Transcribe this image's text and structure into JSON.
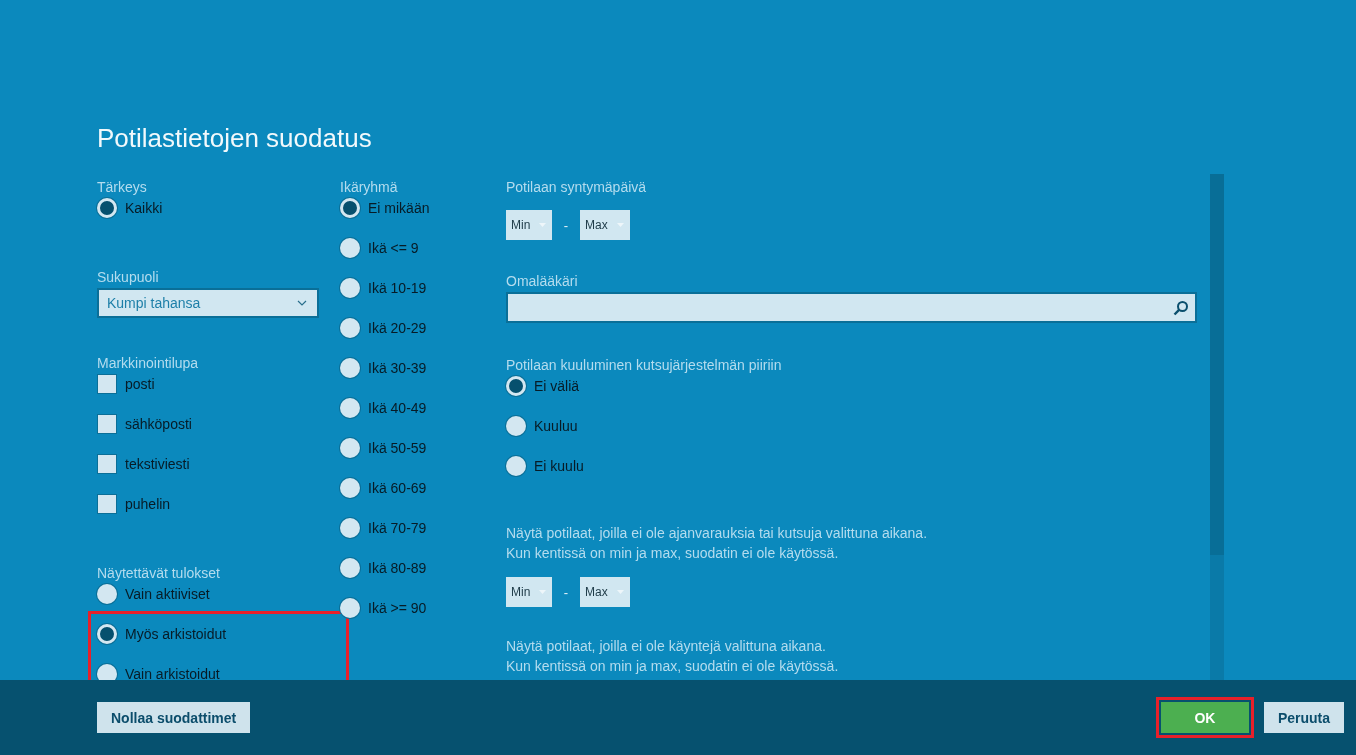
{
  "dialog": {
    "title": "Potilastietojen suodatus"
  },
  "columns": [
    [
      {
        "kind": "radio",
        "label": "Tärkeys",
        "options": [
          {
            "label": "Kaikki",
            "selected": true,
            "highlighted": false
          }
        ]
      },
      {
        "kind": "select",
        "label": "Sukupuoli",
        "value": "Kumpi tahansa"
      },
      {
        "kind": "checkbox",
        "label": "Markkinointilupa",
        "options": [
          {
            "label": "posti",
            "checked": false
          },
          {
            "label": "sähköposti",
            "checked": false
          },
          {
            "label": "tekstiviesti",
            "checked": false
          },
          {
            "label": "puhelin",
            "checked": false
          }
        ]
      },
      {
        "kind": "radio",
        "label": "Näytettävät tulokset",
        "options": [
          {
            "label": "Vain aktiiviset",
            "selected": false,
            "highlighted": false
          },
          {
            "label": "Myös arkistoidut",
            "selected": true,
            "highlighted": true
          },
          {
            "label": "Vain arkistoidut",
            "selected": false,
            "highlighted": true
          }
        ]
      }
    ],
    [
      {
        "kind": "radio",
        "label": "Ikäryhmä",
        "options": [
          {
            "label": "Ei mikään",
            "selected": true,
            "highlighted": false
          },
          {
            "label": "Ikä <= 9",
            "selected": false,
            "highlighted": false
          },
          {
            "label": "Ikä 10-19",
            "selected": false,
            "highlighted": false
          },
          {
            "label": "Ikä 20-29",
            "selected": false,
            "highlighted": false
          },
          {
            "label": "Ikä 30-39",
            "selected": false,
            "highlighted": false
          },
          {
            "label": "Ikä 40-49",
            "selected": false,
            "highlighted": false
          },
          {
            "label": "Ikä 50-59",
            "selected": false,
            "highlighted": false
          },
          {
            "label": "Ikä 60-69",
            "selected": false,
            "highlighted": false
          },
          {
            "label": "Ikä 70-79",
            "selected": false,
            "highlighted": false
          },
          {
            "label": "Ikä 80-89",
            "selected": false,
            "highlighted": false
          },
          {
            "label": "Ikä >= 90",
            "selected": false,
            "highlighted": false
          }
        ]
      }
    ],
    [
      {
        "kind": "range",
        "label": "Potilaan syntymäpäivä",
        "min": "Min",
        "separator": "-",
        "max": "Max"
      },
      {
        "kind": "search",
        "label": "Omalääkäri"
      },
      {
        "kind": "radio",
        "label": "Potilaan kuuluminen kutsujärjestelmän piiriin",
        "options": [
          {
            "label": "Ei väliä",
            "selected": true,
            "highlighted": false
          },
          {
            "label": "Kuuluu",
            "selected": false,
            "highlighted": false
          },
          {
            "label": "Ei kuulu",
            "selected": false,
            "highlighted": false
          }
        ]
      },
      {
        "kind": "range",
        "note": [
          "Näytä potilaat, joilla ei ole ajanvarauksia tai kutsuja valittuna aikana.",
          "Kun kentissä on min ja max, suodatin ei ole käytössä."
        ],
        "min": "Min",
        "separator": "-",
        "max": "Max"
      },
      {
        "kind": "note",
        "note": [
          "Näytä potilaat, joilla ei ole käyntejä valittuna aikana.",
          "Kun kentissä on min ja max, suodatin ei ole käytössä."
        ]
      }
    ]
  ],
  "buttons": [
    {
      "label": "Nollaa suodattimet",
      "kind": "secondary",
      "highlighted": false
    },
    {
      "label": "OK",
      "kind": "primary",
      "highlighted": true
    },
    {
      "label": "Peruuta",
      "kind": "secondary",
      "highlighted": false
    }
  ]
}
